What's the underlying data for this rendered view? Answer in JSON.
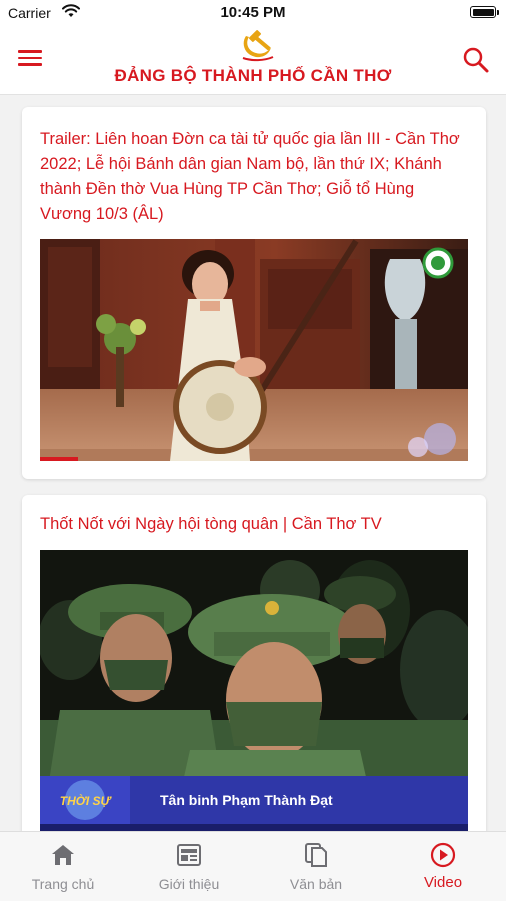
{
  "status_bar": {
    "carrier": "Carrier",
    "time": "10:45 PM"
  },
  "header": {
    "title": "ĐẢNG BỘ THÀNH PHỐ CẦN THƠ",
    "emblem_icon": "hammer-sickle-icon"
  },
  "videos": [
    {
      "title": "Trailer: Liên hoan Đờn ca tài tử quốc gia lần III - Cần Thơ 2022; Lễ hội Bánh dân gian Nam bộ, lần thứ IX; Khánh thành Đền thờ Vua Hùng TP Cần Thơ; Giỗ tổ Hùng Vương 10/3 (ÂL)"
    },
    {
      "title": "Thốt Nốt với Ngày hội tòng quân | Cần Thơ TV",
      "overlay_logo": "THỜI SỰ",
      "caption": "Tân binh Phạm Thành Đạt"
    }
  ],
  "tabs": [
    {
      "label": "Trang chủ",
      "icon": "home-icon"
    },
    {
      "label": "Giới thiệu",
      "icon": "newspaper-icon"
    },
    {
      "label": "Văn bản",
      "icon": "documents-icon"
    },
    {
      "label": "Video",
      "icon": "play-circle-icon"
    }
  ],
  "colors": {
    "brand_red": "#d71920",
    "inactive_tab": "#8e8e93",
    "background": "#f2f2f2"
  }
}
